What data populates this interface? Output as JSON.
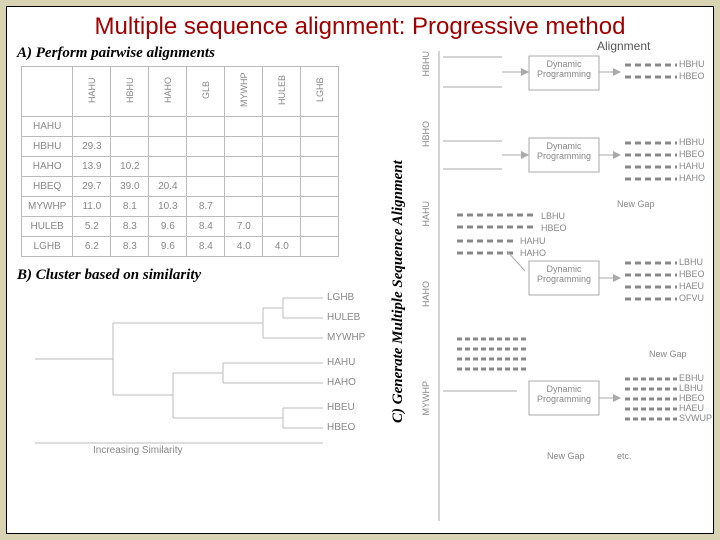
{
  "title": "Multiple  sequence alignment: Progressive method",
  "panelA": {
    "heading": "A) Perform pairwise alignments",
    "cols": [
      "HAHU",
      "HBHU",
      "HAHO",
      "GLB",
      "MYWHP",
      "HULEB",
      "LGHB"
    ],
    "rows": [
      "HAHU",
      "HBHU",
      "HAHO",
      "HBEQ",
      "MYWHP",
      "HULEB",
      "LGHB"
    ],
    "cells": [
      [
        "",
        "",
        "",
        "",
        "",
        "",
        ""
      ],
      [
        "29.3",
        "",
        "",
        "",
        "",
        "",
        ""
      ],
      [
        "13.9",
        "10.2",
        "",
        "",
        "",
        "",
        ""
      ],
      [
        "29.7",
        "39.0",
        "20.4",
        "",
        "",
        "",
        ""
      ],
      [
        "11.0",
        "8.1",
        "10.3",
        "8.7",
        "",
        "",
        ""
      ],
      [
        "5.2",
        "8.3",
        "9.6",
        "8.4",
        "7.0",
        "",
        ""
      ],
      [
        "6.2",
        "8.3",
        "9.6",
        "8.4",
        "4.0",
        "4.0",
        ""
      ]
    ]
  },
  "panelB": {
    "heading": "B) Cluster based on similarity",
    "leaves": [
      "LGHB",
      "HULEB",
      "MYWHP",
      "HAHU",
      "HAHO",
      "HBEU",
      "HBEO"
    ],
    "caption": "Increasing Similarity"
  },
  "panelC": {
    "heading": "C) Generate Multiple Sequence Alignment",
    "step_label": "Dynamic\nProgramming",
    "align_title": "Alignment",
    "new_gap": "New Gap",
    "etc": "etc.",
    "groups": [
      [
        "HBHU",
        "HBEO"
      ],
      [
        "HBHU",
        "HBEO",
        "HAHU",
        "HAHO"
      ],
      [
        "LBHU",
        "HBEO",
        "HAEU",
        "OFVU"
      ],
      [
        "LBHU",
        "HBEO",
        "HAHU",
        "HAHO"
      ],
      [
        "EBHU",
        "LBHU",
        "HBEO",
        "HAEU",
        "SVWUP"
      ]
    ],
    "left_axis": [
      "HBHU",
      "HBHO",
      "HAHU",
      "HAHO",
      "MYWHP"
    ]
  }
}
